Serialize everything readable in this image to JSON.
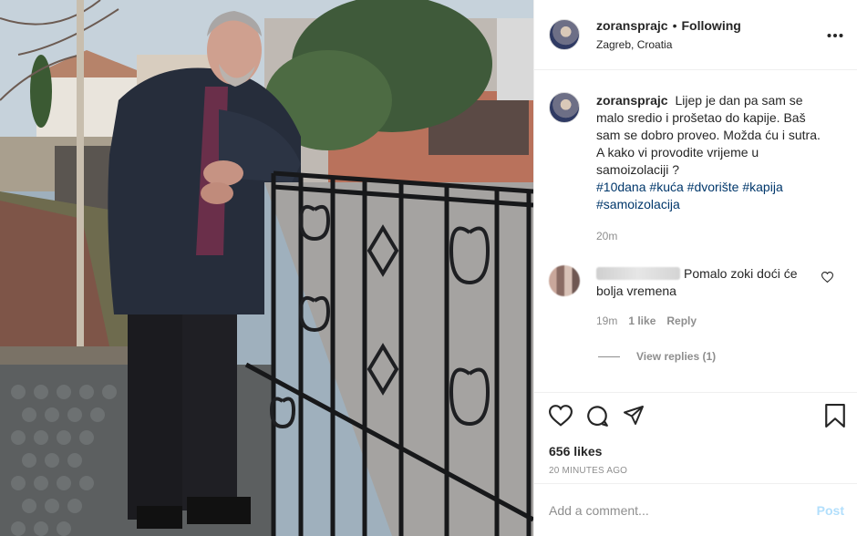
{
  "post": {
    "header": {
      "username": "zoranspraјc",
      "separator": "•",
      "follow_status": "Following",
      "location": "Zagreb, Croatia",
      "more_icon": "more-horizontal-icon"
    },
    "caption": {
      "username": "zoranspraјc",
      "lines": [
        "Lijep je dan pa sam se malo sredio i prošetao do kapije. Baš sam se dobro proveo. Možda ću i sutra.",
        "A kako vi provodite vrijeme u samoizolaciji ?"
      ],
      "hashtags": [
        "#10dana",
        "#kuća",
        "#dvorište",
        "#kapija",
        "#samoizolacija"
      ],
      "time": "20m"
    },
    "comment": {
      "text": "Pomalo zoki doći će bolja vremena",
      "time": "19m",
      "likes": "1 like",
      "reply_label": "Reply",
      "view_replies": "View replies (1)"
    },
    "actions": {
      "likes": "656 likes",
      "ago": "20 MINUTES AGO",
      "icons": [
        "heart-icon",
        "comment-icon",
        "share-icon",
        "bookmark-icon"
      ]
    },
    "composer": {
      "placeholder": "Add a comment...",
      "post_label": "Post"
    }
  },
  "colors": {
    "text": "#262626",
    "secondary": "#8e8e8e",
    "hashtag": "#00376b",
    "post_disabled": "#b2dffc",
    "border": "#efefef"
  }
}
